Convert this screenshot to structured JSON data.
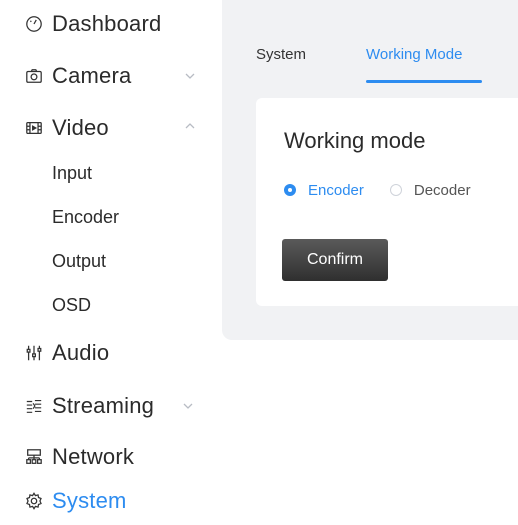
{
  "sidebar": {
    "items": [
      {
        "label": "Dashboard",
        "icon": "dashboard-gauge-icon"
      },
      {
        "label": "Camera",
        "icon": "camera-icon",
        "expandable": true,
        "expanded": false
      },
      {
        "label": "Video",
        "icon": "video-film-icon",
        "expandable": true,
        "expanded": true
      },
      {
        "label": "Audio",
        "icon": "audio-mixer-icon"
      },
      {
        "label": "Streaming",
        "icon": "streaming-icon",
        "expandable": true,
        "expanded": false
      },
      {
        "label": "Network",
        "icon": "network-icon"
      },
      {
        "label": "System",
        "icon": "system-gear-icon",
        "active": true
      }
    ],
    "video_subitems": [
      "Input",
      "Encoder",
      "Output",
      "OSD"
    ]
  },
  "tabs": [
    {
      "label": "System",
      "active": false
    },
    {
      "label": "Working Mode",
      "active": true
    }
  ],
  "card": {
    "title": "Working mode",
    "options": [
      {
        "label": "Encoder",
        "checked": true
      },
      {
        "label": "Decoder",
        "checked": false
      }
    ],
    "confirm_label": "Confirm"
  },
  "colors": {
    "accent": "#2d8cf0",
    "content_background": "#f1f2f4",
    "button_dark": "#3a3a3a"
  }
}
